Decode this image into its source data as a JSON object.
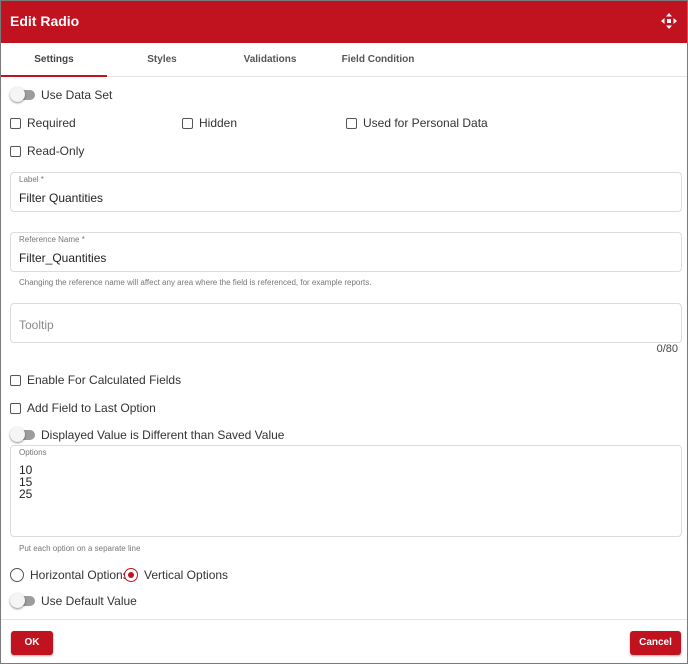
{
  "dialog": {
    "title": "Edit Radio",
    "move_icon": "move-arrows-icon"
  },
  "tabs": [
    {
      "label": "Settings",
      "active": true
    },
    {
      "label": "Styles",
      "active": false
    },
    {
      "label": "Validations",
      "active": false
    },
    {
      "label": "Field Condition",
      "active": false
    }
  ],
  "settings": {
    "use_data_set": {
      "label": "Use Data Set",
      "on": false
    },
    "required": {
      "label": "Required",
      "checked": false
    },
    "hidden": {
      "label": "Hidden",
      "checked": false
    },
    "personal_data": {
      "label": "Used for Personal Data",
      "checked": false
    },
    "read_only": {
      "label": "Read-Only",
      "checked": false
    },
    "label_field": {
      "label": "Label *",
      "value": "Filter Quantities"
    },
    "reference_field": {
      "label": "Reference Name *",
      "value": "Filter_Quantities",
      "hint": "Changing the reference name will affect any area where the field is referenced, for example reports."
    },
    "tooltip_field": {
      "placeholder": "Tooltip",
      "counter": "0/80"
    },
    "calculated": {
      "label": "Enable For Calculated Fields",
      "checked": false
    },
    "add_last_option": {
      "label": "Add Field to Last Option",
      "checked": false
    },
    "displayed_value": {
      "label": "Displayed Value is Different than Saved Value",
      "on": false
    },
    "options_field": {
      "label": "Options",
      "values": [
        "10",
        "15",
        "25"
      ],
      "hint": "Put each option on a separate line"
    },
    "orientation": {
      "horizontal_label": "Horizontal Options",
      "vertical_label": "Vertical Options",
      "selected": "vertical"
    },
    "use_default": {
      "label": "Use Default Value",
      "on": false
    }
  },
  "footer": {
    "ok_label": "OK",
    "cancel_label": "Cancel"
  },
  "colors": {
    "brand": "#c1121f",
    "toggle_off": "#9c9c9c"
  }
}
